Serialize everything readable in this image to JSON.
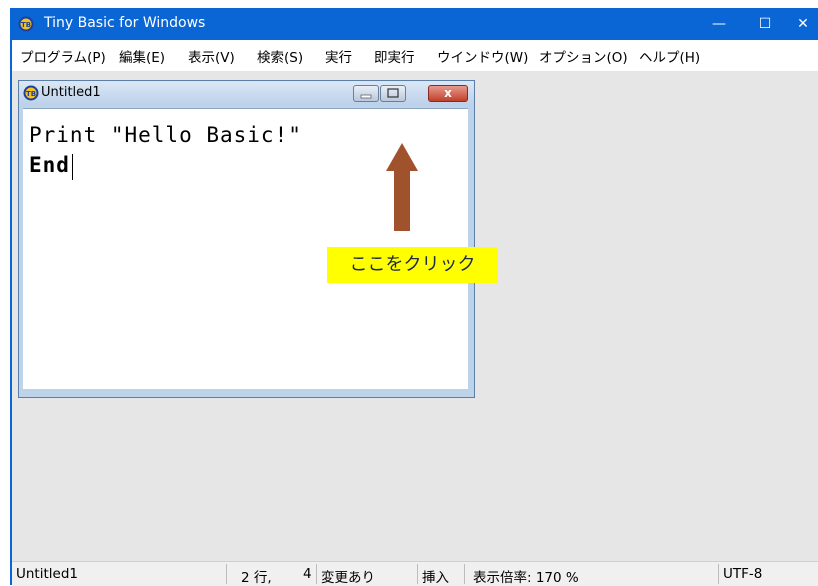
{
  "window": {
    "title": "Tiny Basic for Windows",
    "controls": {
      "minimize": "—",
      "maximize": "☐",
      "close": "✕"
    }
  },
  "menu": {
    "items": [
      "プログラム(P)",
      "編集(E)",
      "表示(V)",
      "検索(S)",
      "実行",
      "即実行",
      "ウインドウ(W)",
      "オプション(O)",
      "ヘルプ(H)"
    ]
  },
  "child_window": {
    "title": "Untitled1",
    "close_label": "x"
  },
  "editor": {
    "lines": [
      "Print \"Hello Basic!\"",
      "End"
    ]
  },
  "annotation": {
    "callout": "ここをクリック",
    "arrow_color": "#a0522d",
    "callout_bg": "#ffff00"
  },
  "status": {
    "file": "Untitled1",
    "line": "2 行,",
    "col": "4",
    "modified": "変更あり",
    "mode": "挿入",
    "zoom": "表示倍率: 170 %",
    "encoding": "UTF-8"
  },
  "colors": {
    "titlebar": "#0a66d4",
    "client_bg": "#e6e6e6"
  }
}
